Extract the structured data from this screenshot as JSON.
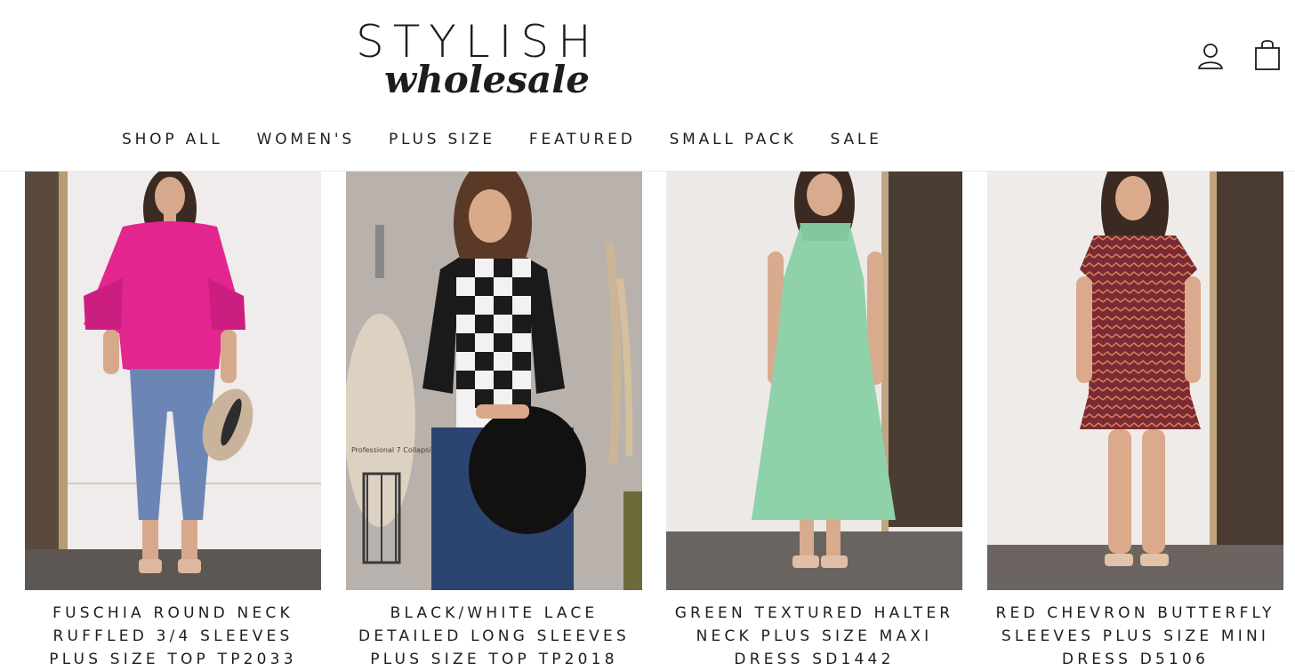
{
  "brand": {
    "name_top": "STYLISH",
    "name_bottom": "wholesale"
  },
  "header_icons": {
    "account": "user-icon",
    "cart": "shopping-bag-icon"
  },
  "nav": {
    "items": [
      {
        "label": "SHOP ALL"
      },
      {
        "label": "WOMEN'S"
      },
      {
        "label": "PLUS SIZE"
      },
      {
        "label": "FEATURED"
      },
      {
        "label": "SMALL PACK"
      },
      {
        "label": "SALE"
      }
    ]
  },
  "products": [
    {
      "title": "FUSCHIA ROUND NECK RUFFLED 3/4 SLEEVES PLUS SIZE TOP TP2033",
      "image": "model-fuschia-top-photo"
    },
    {
      "title": "BLACK/WHITE LACE DETAILED LONG SLEEVES PLUS SIZE TOP TP2018",
      "image": "model-black-white-top-photo",
      "image_text": "Professional 7 Collapsible"
    },
    {
      "title": "GREEN TEXTURED HALTER NECK PLUS SIZE MAXI DRESS SD1442",
      "image": "model-green-dress-photo"
    },
    {
      "title": "RED CHEVRON BUTTERFLY SLEEVES PLUS SIZE MINI DRESS D5106",
      "image": "model-red-dress-photo"
    }
  ],
  "colors": {
    "text": "#1c1d1d",
    "background": "#ffffff",
    "fuschia": "#e3258f",
    "green": "#8fd1a9",
    "red": "#7a2a33"
  }
}
